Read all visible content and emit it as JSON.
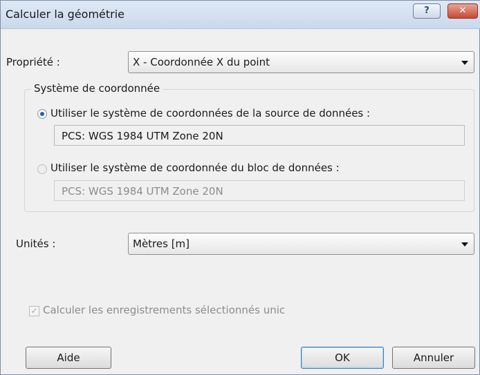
{
  "window": {
    "title": "Calculer la géométrie",
    "help_glyph": "?",
    "close_glyph": "✕"
  },
  "property": {
    "label": "Propriété :",
    "value": "X - Coordonnée X du point"
  },
  "coordinate_system": {
    "legend": "Système de coordonnée",
    "option_source": {
      "label": "Utiliser le système de coordonnées de la source de données :",
      "selected": true,
      "value": "PCS: WGS 1984 UTM Zone 20N"
    },
    "option_block": {
      "label": "Utiliser le système de coordonnée du bloc de données :",
      "selected": false,
      "value": "PCS: WGS 1984 UTM Zone 20N"
    }
  },
  "units": {
    "label": "Unités :",
    "value": "Mètres [m]"
  },
  "selected_only": {
    "label": "Calculer les enregistrements sélectionnés unic",
    "checked": true,
    "check_glyph": "✓"
  },
  "buttons": {
    "help": "Aide",
    "ok": "OK",
    "cancel": "Annuler"
  },
  "icons": {
    "help": "help-icon",
    "close": "close-icon",
    "dropdown": "chevron-down-icon"
  }
}
